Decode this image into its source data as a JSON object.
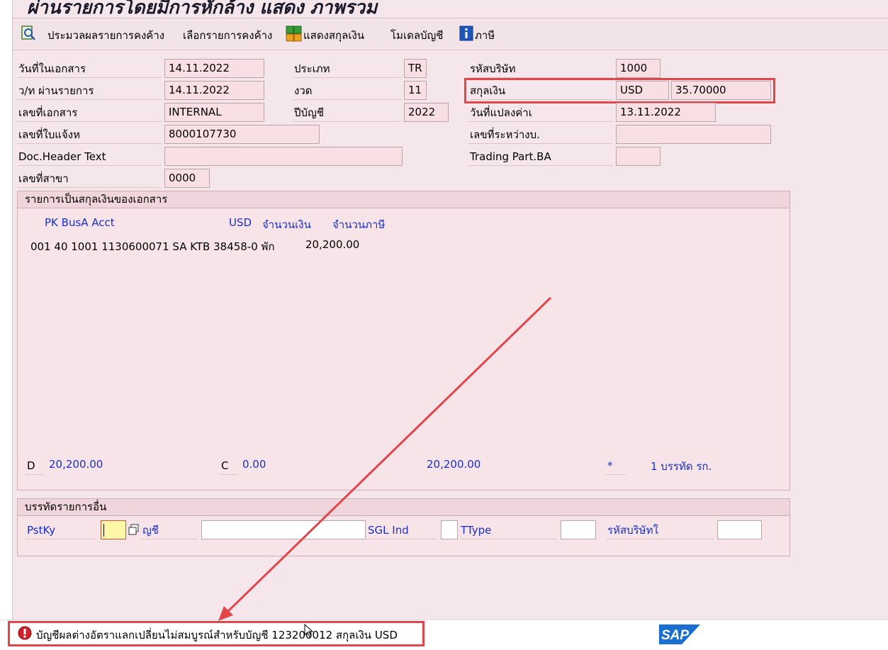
{
  "window": {
    "title": "ผ่านรายการโดยมีการหักล้าง แสดง ภาพรวม"
  },
  "toolbar": {
    "btn1": "ประมวลผลรายการคงค้าง",
    "btn2": "เลือกรายการคงค้าง",
    "btn3": "แสดงสกุลเงิน",
    "btn4": "โมเดลบัญชี",
    "btn5": "ภาษี"
  },
  "header": {
    "doc_date_label": "วันที่ในเอกสาร",
    "doc_date": "14.11.2022",
    "post_date_label": "ว/ท ผ่านรายการ",
    "post_date": "14.11.2022",
    "doc_no_label": "เลขที่เอกสาร",
    "doc_no": "INTERNAL",
    "ref_label": "เลขที่ใบแจ้งห",
    "ref": "8000107730",
    "header_text_label": "Doc.Header Text",
    "header_text": "",
    "branch_label": "เลขที่สาขา",
    "branch": "0000",
    "type_label": "ประเภท",
    "type": "TR",
    "period_label": "งวด",
    "period": "11",
    "fiscal_year_label": "ปีบัญชี",
    "fiscal_year": "2022",
    "company_label": "รหัสบริษัท",
    "company": "1000",
    "currency_label": "สกุลเงิน",
    "currency": "USD",
    "rate": "35.70000",
    "trans_date_label": "วันที่แปลงค่าเ",
    "trans_date": "13.11.2022",
    "intercompany_label": "เลขที่ระหว่างบ.",
    "intercompany": "",
    "trading_partner_label": "Trading Part.BA",
    "trading_partner": ""
  },
  "items_group": {
    "title": "รายการเป็นสกุลเงินของเอกสาร",
    "col_pk_busa_acct": "PK  BusA Acct",
    "col_currency": "USD",
    "col_amount": "จำนวนเงิน",
    "col_tax": "จำนวนภาษี",
    "row1_text": "001 40  1001 1130600071 SA KTB 38458-0 พัก",
    "row1_amount": "20,200.00",
    "debit_label": "D",
    "debit_total": "20,200.00",
    "credit_label": "C",
    "credit_total": "0.00",
    "balance": "20,200.00",
    "star": "*",
    "lines_text": "1  บรรทัด รก."
  },
  "other_lines_group": {
    "title": "บรรทัดรายการอื่น",
    "pstky_label": "PstKy",
    "pstky": "",
    "account_label": "ญชี",
    "account": "",
    "sgl_label": "SGL Ind",
    "sgl": "",
    "ttype_label": "TType",
    "ttype": "",
    "company_label": "รหัสบริษัทใ",
    "company": ""
  },
  "status": {
    "message": "บัญชีผลต่างอัตราแลกเปลี่ยนไม่สมบูรณ์สำหรับบัญชี 123​200012 สกุลเงิน USD",
    "logo": "SAP"
  },
  "colors": {
    "annotation": "#e0464a",
    "blue_text": "#1a2fc8",
    "field_bg": "#f8dfe4"
  }
}
